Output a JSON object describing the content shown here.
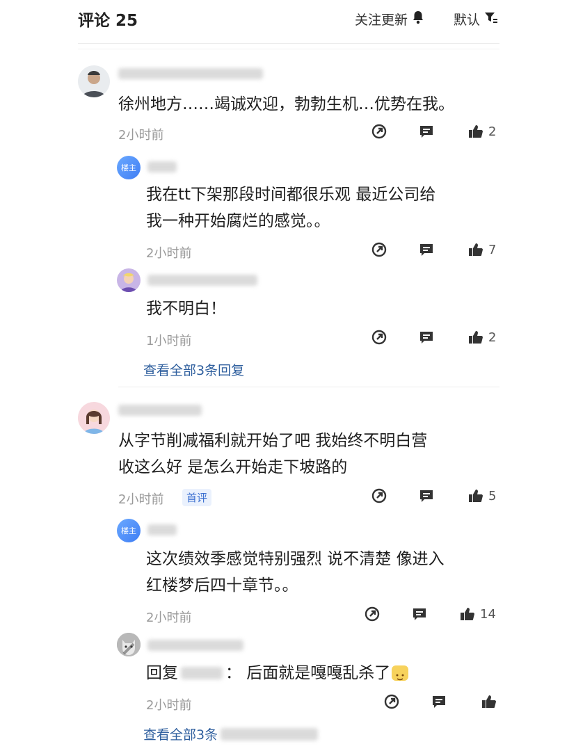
{
  "header": {
    "title": "评论 25",
    "follow_label": "关注更新",
    "sort_label": "默认"
  },
  "comments": [
    {
      "text": "徐州地方……竭诚欢迎，勃勃生机…优势在我。",
      "time": "2小时前",
      "likes": "2",
      "replies": [
        {
          "badge": "楼主",
          "text_lines": [
            "我在tt下架那段时间都很乐观 最近公司给",
            "我一种开始腐烂的感觉。。"
          ],
          "time": "2小时前",
          "likes": "7"
        },
        {
          "text_lines": [
            "我不明白！"
          ],
          "time": "1小时前",
          "likes": "2"
        }
      ],
      "view_all": "查看全部3条回复"
    },
    {
      "text_lines": [
        "从字节削减福利就开始了吧 我始终不明白营",
        "收这么好 是怎么开始走下坡路的"
      ],
      "time": "2小时前",
      "tag": "首评",
      "likes": "5",
      "replies": [
        {
          "badge": "楼主",
          "text_lines": [
            "这次绩效季感觉特别强烈 说不清楚 像进入",
            "红楼梦后四十章节。。"
          ],
          "time": "2小时前",
          "likes": "14"
        },
        {
          "reply_prefix": "回复",
          "reply_suffix": "： 后面就是嘎嘎乱杀了",
          "time": "2小时前",
          "likes": ""
        }
      ],
      "view_all": "查看全部3条"
    }
  ],
  "icons": {
    "bell": "bell-icon",
    "filter": "filter-icon",
    "share": "share-icon",
    "reply": "comment-icon",
    "like": "thumbs-up-icon"
  },
  "colors": {
    "link": "#2f5f9e",
    "badge_bg": "#eaf1fd",
    "louzhu": "#4a86f5"
  }
}
